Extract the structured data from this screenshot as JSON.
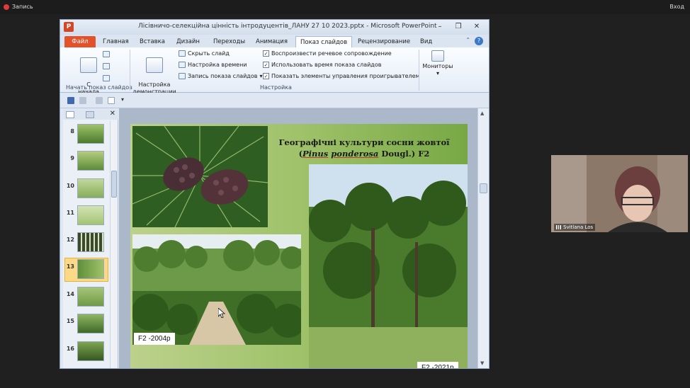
{
  "meeting": {
    "record_label": "Запись",
    "sign_in_label": "Вход",
    "participant_name": "Svitlana Los"
  },
  "window": {
    "title": "Лісівничо-селекційна цінність інтродуцентів_ЛАНУ 27 10 2023.pptx  -  Microsoft PowerPoint",
    "app_icon_letter": "P"
  },
  "tabs": [
    {
      "label": "Файл"
    },
    {
      "label": "Главная"
    },
    {
      "label": "Вставка"
    },
    {
      "label": "Дизайн"
    },
    {
      "label": "Переходы"
    },
    {
      "label": "Анимация"
    },
    {
      "label": "Показ слайдов"
    },
    {
      "label": "Рецензирование"
    },
    {
      "label": "Вид"
    }
  ],
  "ribbon": {
    "from_start": "С\nначала",
    "setup_show": "Настройка\nдемонстрации",
    "hide_slide": "Скрыть слайд",
    "rehearse": "Настройка времени",
    "record_show": "Запись показа слайдов",
    "play_narration": "Воспроизвести речевое сопровождение",
    "use_timings": "Использовать время показа слайдов",
    "show_media_controls": "Показать элементы управления проигрывателем",
    "monitors": "Мониторы",
    "group_start": "Начать показ слайдов",
    "group_setup": "Настройка"
  },
  "thumbnails": [
    {
      "num": "8"
    },
    {
      "num": "9"
    },
    {
      "num": "10"
    },
    {
      "num": "11"
    },
    {
      "num": "12"
    },
    {
      "num": "13"
    },
    {
      "num": "14"
    },
    {
      "num": "15"
    },
    {
      "num": "16"
    }
  ],
  "slide": {
    "title_part1": "Географічні культури сосни жовтої (",
    "title_latin1": "Pinus",
    "title_latin2": "ponderosa",
    "title_part2": " Dougl.)  F2",
    "caption_left": "F2  -2004р",
    "caption_right": "F2  -2021р"
  },
  "colors": {
    "file_tab": "#e2522b",
    "selected_thumb": "#fcd986",
    "slide_green": "#9fc26a"
  }
}
